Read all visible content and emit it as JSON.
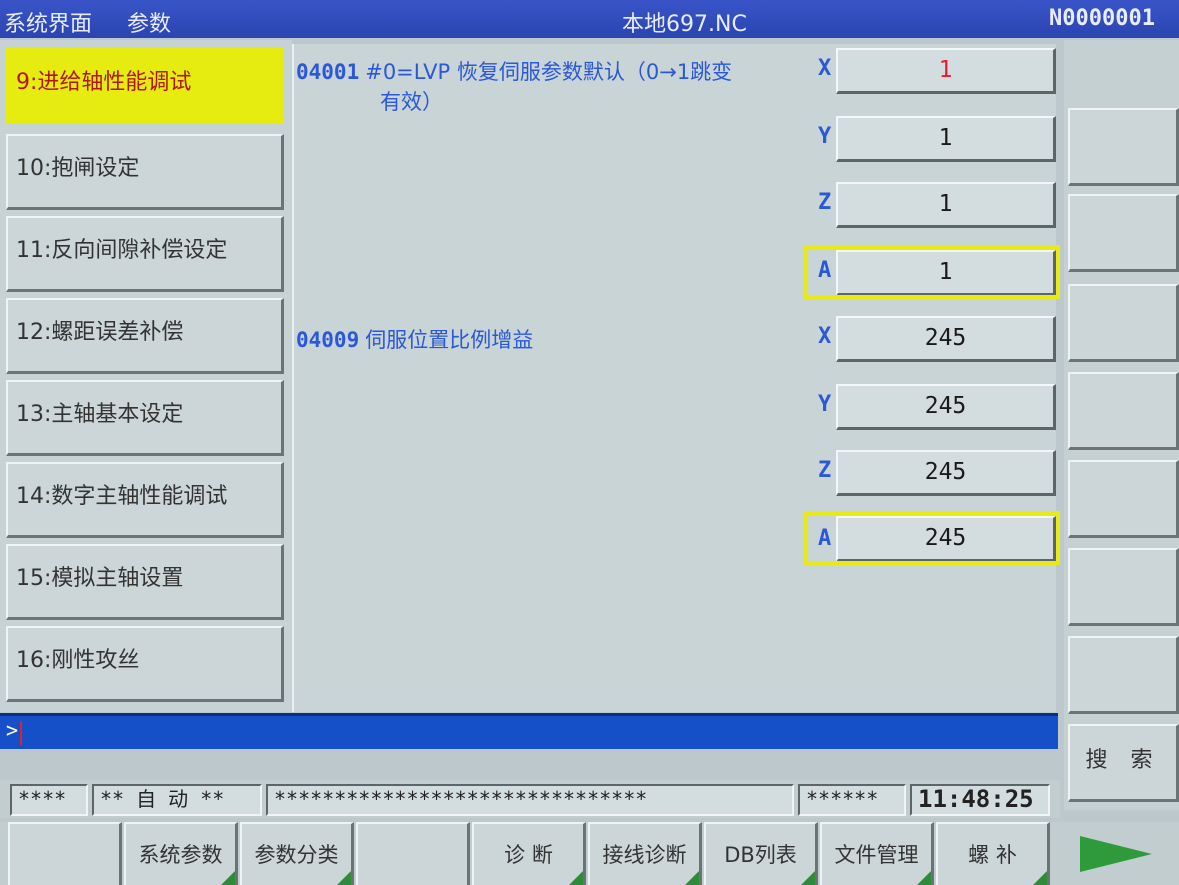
{
  "title_bar": {
    "menu_system": "系统界面",
    "menu_params": "参数",
    "program_name": "本地697.NC",
    "block_number": "N0000001"
  },
  "menu": {
    "items": [
      {
        "label": "9:进给轴性能调试",
        "active": true
      },
      {
        "label": "10:抱闸设定"
      },
      {
        "label": "11:反向间隙补偿设定"
      },
      {
        "label": "12:螺距误差补偿"
      },
      {
        "label": "13:主轴基本设定"
      },
      {
        "label": "14:数字主轴性能调试"
      },
      {
        "label": "15:模拟主轴设置"
      },
      {
        "label": "16:刚性攻丝"
      }
    ]
  },
  "params": [
    {
      "code": "04001",
      "desc_line1": "#0=LVP 恢复伺服参数默认（0→1跳变",
      "desc_line2": "有效）",
      "axes": [
        {
          "axis": "X",
          "value": "1"
        },
        {
          "axis": "Y",
          "value": "1"
        },
        {
          "axis": "Z",
          "value": "1"
        },
        {
          "axis": "A",
          "value": "1"
        }
      ]
    },
    {
      "code": "04009",
      "desc_line1": "伺服位置比例增益",
      "axes": [
        {
          "axis": "X",
          "value": "245"
        },
        {
          "axis": "Y",
          "value": "245"
        },
        {
          "axis": "Z",
          "value": "245"
        },
        {
          "axis": "A",
          "value": "245"
        }
      ]
    }
  ],
  "command_line": {
    "prompt": ">"
  },
  "status_bar": {
    "field1": "****",
    "mode": "** 自 动 **",
    "message": "*******************************",
    "field4": "******",
    "time": "11:48:25"
  },
  "right_buttons": {
    "search": "搜 索"
  },
  "function_keys": [
    {
      "label": ""
    },
    {
      "label": "系统参数"
    },
    {
      "label": "参数分类"
    },
    {
      "label": ""
    },
    {
      "label": "诊 断"
    },
    {
      "label": "接线诊断"
    },
    {
      "label": "DB列表"
    },
    {
      "label": "文件管理"
    },
    {
      "label": "螺 补"
    }
  ],
  "colors": {
    "title_bar": "#2a44b0",
    "active_menu": "#e6ec10",
    "param_text": "#2a58d6",
    "highlight_box": "#e8ea18",
    "command_bar": "#1650c8",
    "red_value": "#e02030",
    "softkey_corner": "#2e8b3a"
  }
}
